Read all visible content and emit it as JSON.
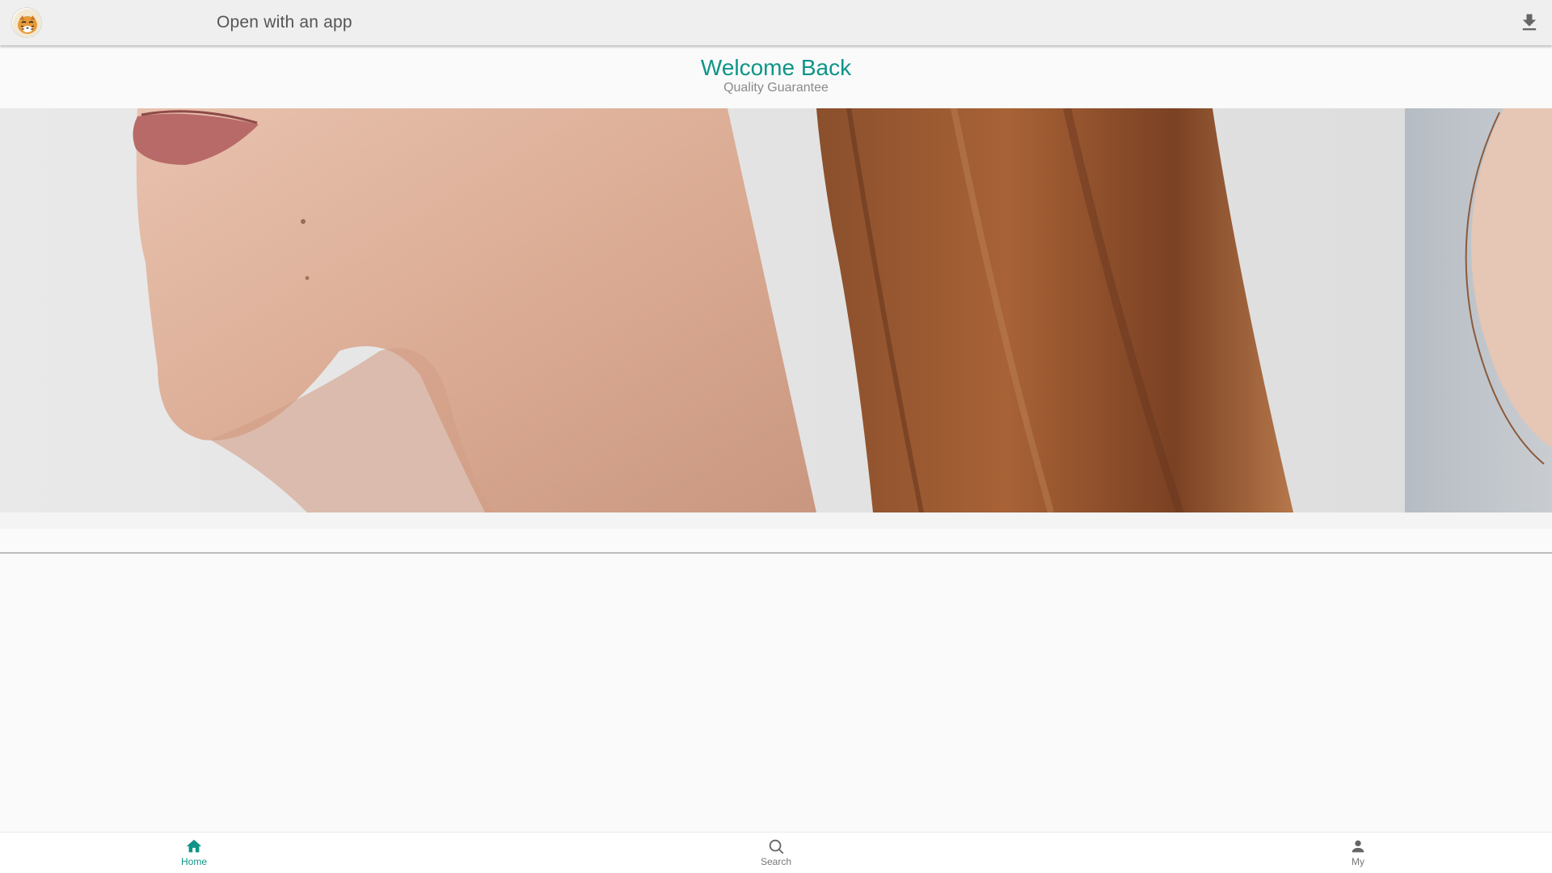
{
  "topbar": {
    "open_app_label": "Open with an app",
    "logo_icon": "tiger-logo-icon",
    "download_icon": "download-icon"
  },
  "welcome": {
    "title": "Welcome Back",
    "subtitle": "Quality Guarantee"
  },
  "banner": {
    "image": "model-neck-hair-photo"
  },
  "bottom_nav": {
    "items": [
      {
        "label": "Home",
        "icon": "home-icon",
        "active": true
      },
      {
        "label": "Search",
        "icon": "search-icon",
        "active": false
      },
      {
        "label": "My",
        "icon": "person-icon",
        "active": false
      }
    ]
  },
  "colors": {
    "accent": "#0f9488",
    "muted_text": "#8a8a8a",
    "topbar_bg": "#efefef"
  }
}
